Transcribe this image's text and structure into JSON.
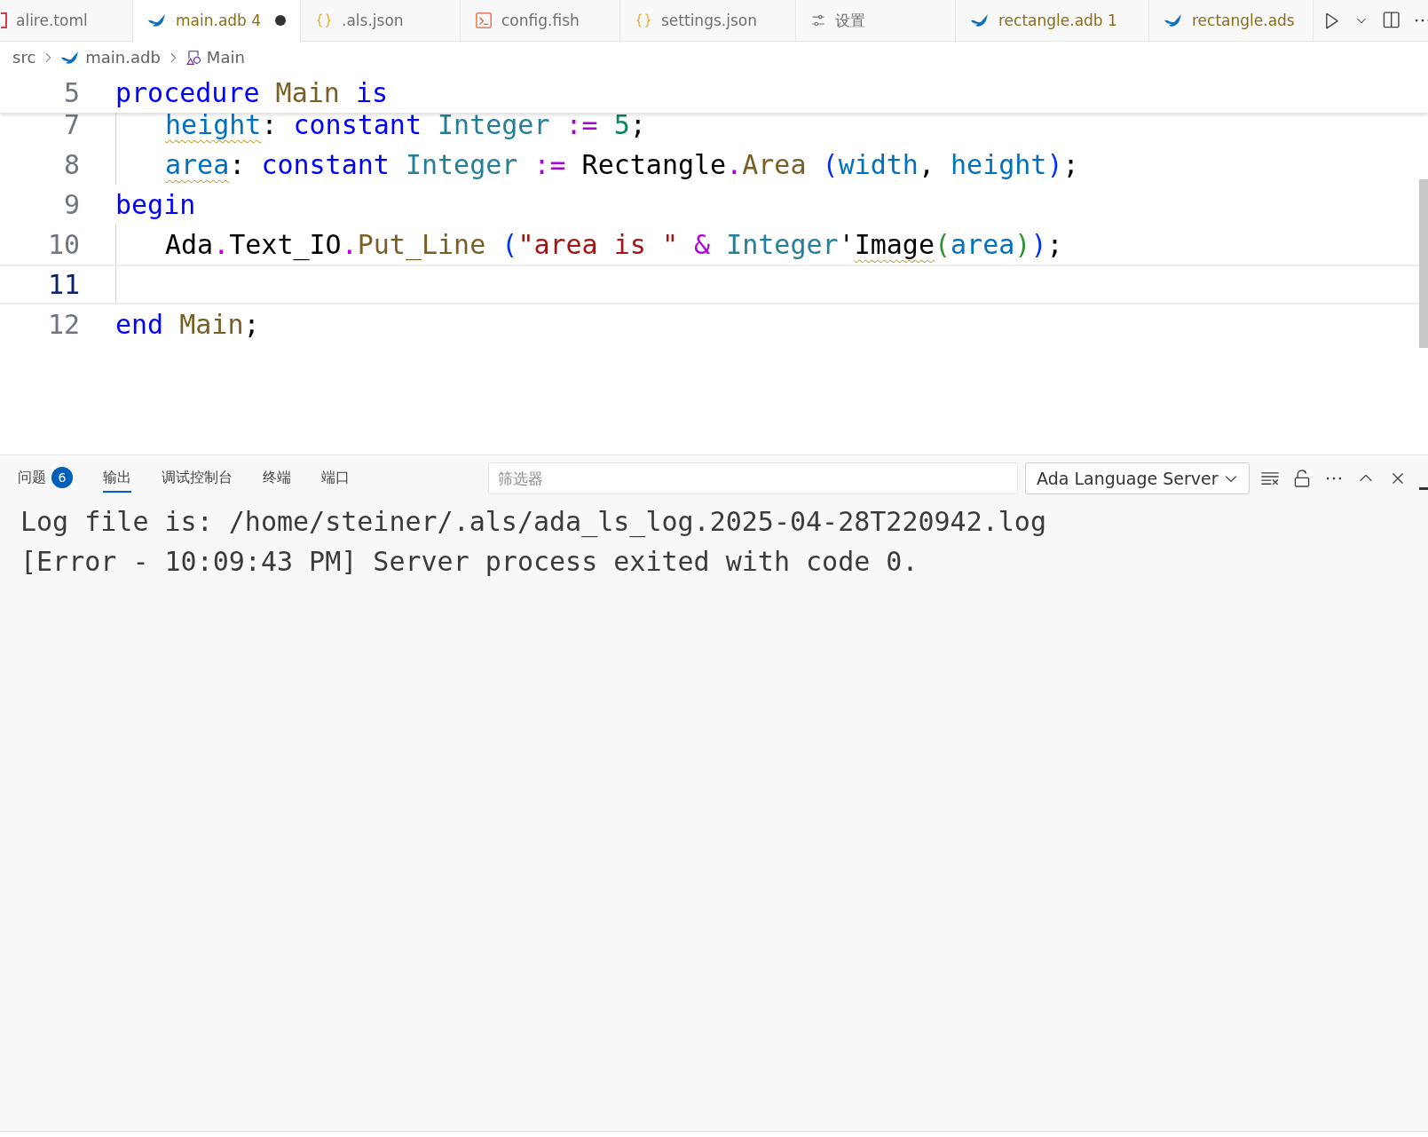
{
  "tabs": [
    {
      "label": "alire.toml",
      "kind": "toml",
      "selected": false,
      "has_warnings": false,
      "modified": false
    },
    {
      "label": "main.adb",
      "kind": "ada",
      "badge": "4",
      "selected": true,
      "has_warnings": true,
      "modified": true
    },
    {
      "label": ".als.json",
      "kind": "json",
      "selected": false,
      "has_warnings": false,
      "modified": false
    },
    {
      "label": "config.fish",
      "kind": "terminal",
      "selected": false,
      "has_warnings": false,
      "modified": false
    },
    {
      "label": "settings.json",
      "kind": "json",
      "selected": false,
      "has_warnings": false,
      "modified": false
    },
    {
      "label": "设置",
      "kind": "settings",
      "selected": false,
      "has_warnings": false,
      "modified": false
    },
    {
      "label": "rectangle.adb",
      "kind": "ada",
      "badge": "1",
      "selected": false,
      "has_warnings": true,
      "modified": false
    },
    {
      "label": "rectangle.ads",
      "kind": "ada",
      "selected": false,
      "has_warnings": true,
      "modified": false
    }
  ],
  "breadcrumb": [
    {
      "label": "src",
      "kind": "folder"
    },
    {
      "label": "main.adb",
      "kind": "ada"
    },
    {
      "label": "Main",
      "kind": "symbol"
    }
  ],
  "sticky_line": {
    "number": "5",
    "current": false,
    "indented": false,
    "tokens": [
      {
        "text": "procedure",
        "kind": "keyword",
        "warning": false
      },
      {
        "text": " Main",
        "kind": "func",
        "warning": false
      },
      {
        "text": " is",
        "kind": "keyword",
        "warning": false
      }
    ]
  },
  "lines": [
    {
      "number": "7",
      "current": false,
      "indented": true,
      "tokens": [
        {
          "text": "height",
          "kind": "var",
          "warning": true
        },
        {
          "text": ": ",
          "kind": "plain",
          "warning": false
        },
        {
          "text": "constant",
          "kind": "keyword",
          "warning": false
        },
        {
          "text": " Integer",
          "kind": "type",
          "warning": false
        },
        {
          "text": " :=",
          "kind": "op",
          "warning": false
        },
        {
          "text": " 5",
          "kind": "number",
          "warning": false
        },
        {
          "text": ";",
          "kind": "plain",
          "warning": false
        }
      ]
    },
    {
      "number": "8",
      "current": false,
      "indented": true,
      "tokens": [
        {
          "text": "area",
          "kind": "var",
          "warning": true
        },
        {
          "text": ": ",
          "kind": "plain",
          "warning": false
        },
        {
          "text": "constant",
          "kind": "keyword",
          "warning": false
        },
        {
          "text": " Integer",
          "kind": "type",
          "warning": false
        },
        {
          "text": " :=",
          "kind": "op",
          "warning": false
        },
        {
          "text": " Rectangle",
          "kind": "plain",
          "warning": false
        },
        {
          "text": ".",
          "kind": "op",
          "warning": false
        },
        {
          "text": "Area",
          "kind": "func",
          "warning": false
        },
        {
          "text": " (",
          "kind": "paren",
          "warning": false
        },
        {
          "text": "width",
          "kind": "var",
          "warning": false
        },
        {
          "text": ", ",
          "kind": "plain",
          "warning": false
        },
        {
          "text": "height",
          "kind": "var",
          "warning": false
        },
        {
          "text": ")",
          "kind": "paren",
          "warning": false
        },
        {
          "text": ";",
          "kind": "plain",
          "warning": false
        }
      ]
    },
    {
      "number": "9",
      "current": false,
      "indented": false,
      "tokens": [
        {
          "text": "begin",
          "kind": "keyword",
          "warning": false
        }
      ]
    },
    {
      "number": "10",
      "current": false,
      "indented": true,
      "tokens": [
        {
          "text": "Ada",
          "kind": "plain",
          "warning": false
        },
        {
          "text": ".",
          "kind": "op",
          "warning": false
        },
        {
          "text": "Text_IO",
          "kind": "plain",
          "warning": false
        },
        {
          "text": ".",
          "kind": "op",
          "warning": false
        },
        {
          "text": "Put_Line",
          "kind": "func",
          "warning": false
        },
        {
          "text": " (",
          "kind": "paren",
          "warning": false
        },
        {
          "text": "\"area is \"",
          "kind": "string",
          "warning": false
        },
        {
          "text": " &",
          "kind": "op",
          "warning": false
        },
        {
          "text": " Integer",
          "kind": "type",
          "warning": false
        },
        {
          "text": "'",
          "kind": "plain",
          "warning": false
        },
        {
          "text": "Image",
          "kind": "plain",
          "warning": true
        },
        {
          "text": "(",
          "kind": "paren2",
          "warning": false
        },
        {
          "text": "area",
          "kind": "var",
          "warning": false
        },
        {
          "text": ")",
          "kind": "paren2",
          "warning": false
        },
        {
          "text": ")",
          "kind": "paren",
          "warning": false
        },
        {
          "text": ";",
          "kind": "plain",
          "warning": false
        }
      ]
    },
    {
      "number": "11",
      "current": true,
      "indented": true
    },
    {
      "number": "12",
      "current": false,
      "indented": false,
      "tokens": [
        {
          "text": "end",
          "kind": "keyword",
          "warning": false
        },
        {
          "text": " Main",
          "kind": "func",
          "warning": false
        },
        {
          "text": ";",
          "kind": "plain",
          "warning": false
        }
      ]
    }
  ],
  "panel": {
    "tabs": [
      {
        "label": "问题",
        "badge": "6",
        "selected": false
      },
      {
        "label": "输出",
        "selected": true
      },
      {
        "label": "调试控制台",
        "selected": false
      },
      {
        "label": "终端",
        "selected": false
      },
      {
        "label": "端口",
        "selected": false
      }
    ],
    "filter": {
      "placeholder": "筛选器"
    },
    "channel": "Ada Language Server",
    "output": [
      "Log file is: /home/steiner/.als/ada_ls_log.2025-04-28T220942.log",
      "[Error - 10:09:43 PM] Server process exited with code 0."
    ]
  }
}
